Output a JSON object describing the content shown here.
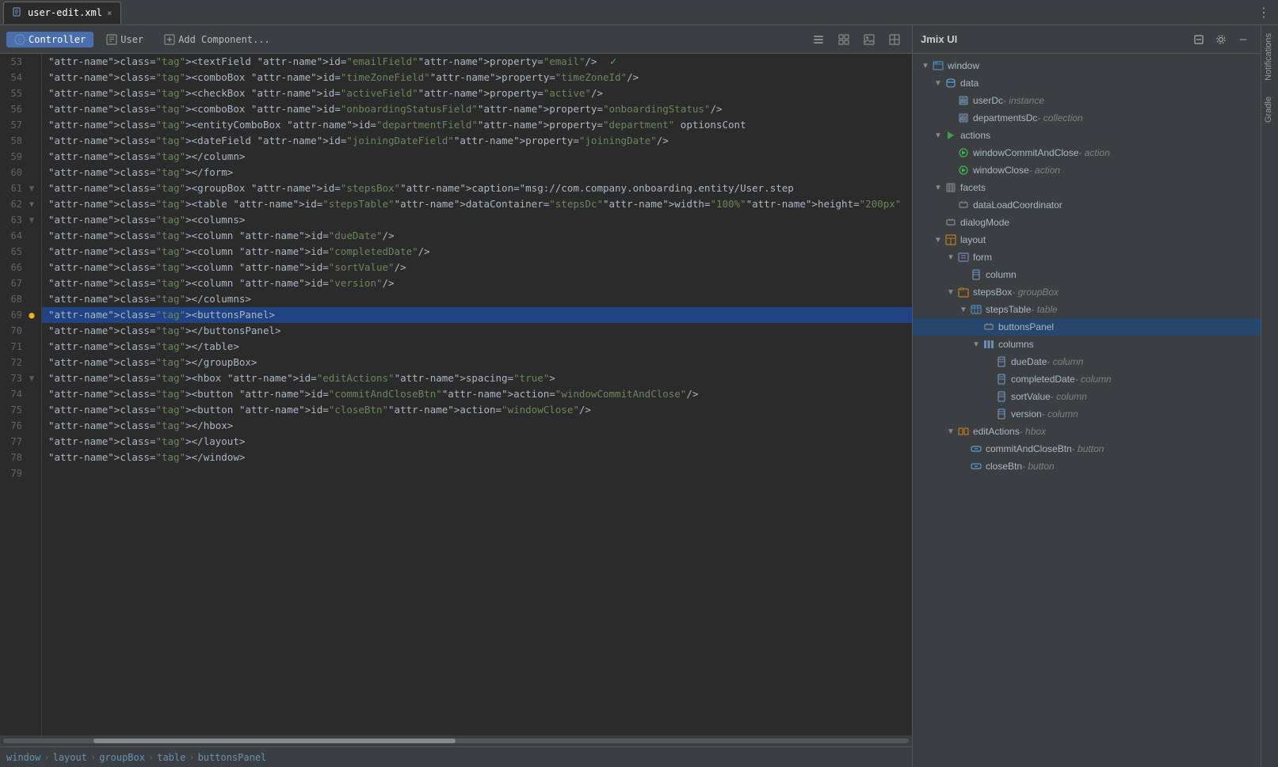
{
  "tab": {
    "filename": "user-edit.xml",
    "close_label": "×"
  },
  "editor_toolbar": {
    "tabs": [
      {
        "id": "controller",
        "label": "Controller",
        "icon": "controller-icon",
        "active": true
      },
      {
        "id": "user",
        "label": "User",
        "icon": "user-icon",
        "active": false
      },
      {
        "id": "add_component",
        "label": "Add Component...",
        "icon": "add-icon",
        "active": false
      }
    ],
    "buttons": [
      "list-view-icon",
      "grid-view-icon",
      "image-icon",
      "image2-icon"
    ]
  },
  "code": {
    "lines": [
      {
        "num": 53,
        "indent": 3,
        "content": "<textField id=\"emailField\" property=\"email\"/>",
        "has_fold": false,
        "has_warning": false,
        "checkmark": true
      },
      {
        "num": 54,
        "indent": 3,
        "content": "<comboBox id=\"timeZoneField\" property=\"timeZoneId\"/>",
        "has_fold": false,
        "has_warning": false
      },
      {
        "num": 55,
        "indent": 3,
        "content": "<checkBox id=\"activeField\" property=\"active\"/>",
        "has_fold": false,
        "has_warning": false
      },
      {
        "num": 56,
        "indent": 3,
        "content": "<comboBox id=\"onboardingStatusField\" property=\"onboardingStatus\"/>",
        "has_fold": false,
        "has_warning": false
      },
      {
        "num": 57,
        "indent": 3,
        "content": "<entityComboBox id=\"departmentField\" property=\"department\" optionsCont",
        "has_fold": false,
        "has_warning": false
      },
      {
        "num": 58,
        "indent": 3,
        "content": "<dateField id=\"joiningDateField\" property=\"joiningDate\"/>",
        "has_fold": false,
        "has_warning": false
      },
      {
        "num": 59,
        "indent": 2,
        "content": "</column>",
        "has_fold": false,
        "has_warning": false
      },
      {
        "num": 60,
        "indent": 2,
        "content": "</form>",
        "has_fold": false,
        "has_warning": false
      },
      {
        "num": 61,
        "indent": 2,
        "content": "<groupBox id=\"stepsBox\" caption=\"msg://com.company.onboarding.entity/User.step",
        "has_fold": true,
        "has_warning": false
      },
      {
        "num": 62,
        "indent": 3,
        "content": "<table id=\"stepsTable\" dataContainer=\"stepsDc\" width=\"100%\" height=\"200px\"",
        "has_fold": true,
        "has_warning": false
      },
      {
        "num": 63,
        "indent": 4,
        "content": "<columns>",
        "has_fold": true,
        "has_warning": false
      },
      {
        "num": 64,
        "indent": 5,
        "content": "<column id=\"dueDate\"/>",
        "has_fold": false,
        "has_warning": false
      },
      {
        "num": 65,
        "indent": 5,
        "content": "<column id=\"completedDate\"/>",
        "has_fold": false,
        "has_warning": false
      },
      {
        "num": 66,
        "indent": 5,
        "content": "<column id=\"sortValue\"/>",
        "has_fold": false,
        "has_warning": false
      },
      {
        "num": 67,
        "indent": 5,
        "content": "<column id=\"version\"/>",
        "has_fold": false,
        "has_warning": false
      },
      {
        "num": 68,
        "indent": 4,
        "content": "</columns>",
        "has_fold": false,
        "has_warning": false
      },
      {
        "num": 69,
        "indent": 4,
        "content": "<buttonsPanel>",
        "has_fold": false,
        "has_warning": true,
        "selected": true
      },
      {
        "num": 70,
        "indent": 4,
        "content": "</buttonsPanel>",
        "has_fold": false,
        "has_warning": false
      },
      {
        "num": 71,
        "indent": 3,
        "content": "</table>",
        "has_fold": false,
        "has_warning": false
      },
      {
        "num": 72,
        "indent": 2,
        "content": "</groupBox>",
        "has_fold": false,
        "has_warning": false
      },
      {
        "num": 73,
        "indent": 2,
        "content": "<hbox id=\"editActions\" spacing=\"true\">",
        "has_fold": true,
        "has_warning": false
      },
      {
        "num": 74,
        "indent": 3,
        "content": "<button id=\"commitAndCloseBtn\" action=\"windowCommitAndClose\"/>",
        "has_fold": false,
        "has_warning": false
      },
      {
        "num": 75,
        "indent": 3,
        "content": "<button id=\"closeBtn\" action=\"windowClose\"/>",
        "has_fold": false,
        "has_warning": false
      },
      {
        "num": 76,
        "indent": 2,
        "content": "</hbox>",
        "has_fold": false,
        "has_warning": false
      },
      {
        "num": 77,
        "indent": 1,
        "content": "</layout>",
        "has_fold": false,
        "has_warning": false
      },
      {
        "num": 78,
        "indent": 0,
        "content": "</window>",
        "has_fold": false,
        "has_warning": false
      },
      {
        "num": 79,
        "indent": 0,
        "content": "",
        "has_fold": false,
        "has_warning": false
      }
    ]
  },
  "breadcrumb": {
    "items": [
      "window",
      "layout",
      "groupBox",
      "table",
      "buttonsPanel"
    ]
  },
  "right_panel": {
    "title": "Jmix UI",
    "tree": {
      "nodes": [
        {
          "id": "window",
          "label": "window",
          "type": "",
          "depth": 0,
          "expanded": true,
          "icon": "window-icon"
        },
        {
          "id": "data",
          "label": "data",
          "type": "",
          "depth": 1,
          "expanded": true,
          "icon": "data-icon"
        },
        {
          "id": "userDc",
          "label": "userDc",
          "type": "instance",
          "depth": 2,
          "expanded": false,
          "icon": "dc-icon"
        },
        {
          "id": "departmentsDc",
          "label": "departmentsDc",
          "type": "collection",
          "depth": 2,
          "expanded": false,
          "icon": "dc-icon"
        },
        {
          "id": "actions",
          "label": "actions",
          "type": "",
          "depth": 1,
          "expanded": true,
          "icon": "actions-icon"
        },
        {
          "id": "windowCommitAndClose",
          "label": "windowCommitAndClose",
          "type": "action",
          "depth": 2,
          "expanded": false,
          "icon": "action-icon"
        },
        {
          "id": "windowClose",
          "label": "windowClose",
          "type": "action",
          "depth": 2,
          "expanded": false,
          "icon": "action-icon"
        },
        {
          "id": "facets",
          "label": "facets",
          "type": "",
          "depth": 1,
          "expanded": true,
          "icon": "facets-icon"
        },
        {
          "id": "dataLoadCoordinator",
          "label": "dataLoadCoordinator",
          "type": "",
          "depth": 2,
          "expanded": false,
          "icon": "component-icon"
        },
        {
          "id": "dialogMode",
          "label": "dialogMode",
          "type": "",
          "depth": 1,
          "expanded": false,
          "icon": "component-icon"
        },
        {
          "id": "layout",
          "label": "layout",
          "type": "",
          "depth": 1,
          "expanded": true,
          "icon": "layout-icon"
        },
        {
          "id": "form",
          "label": "form",
          "type": "",
          "depth": 2,
          "expanded": true,
          "icon": "form-icon"
        },
        {
          "id": "column",
          "label": "column",
          "type": "",
          "depth": 3,
          "expanded": false,
          "icon": "column-icon"
        },
        {
          "id": "stepsBox",
          "label": "stepsBox",
          "type": "groupBox",
          "depth": 2,
          "expanded": true,
          "icon": "groupbox-icon"
        },
        {
          "id": "stepsTable",
          "label": "stepsTable",
          "type": "table",
          "depth": 3,
          "expanded": true,
          "icon": "table-icon"
        },
        {
          "id": "buttonsPanel",
          "label": "buttonsPanel",
          "type": "",
          "depth": 4,
          "expanded": false,
          "icon": "component-icon"
        },
        {
          "id": "columns",
          "label": "columns",
          "type": "",
          "depth": 4,
          "expanded": true,
          "icon": "columns-icon"
        },
        {
          "id": "dueDate",
          "label": "dueDate",
          "type": "column",
          "depth": 5,
          "expanded": false,
          "icon": "column-icon"
        },
        {
          "id": "completedDate",
          "label": "completedDate",
          "type": "column",
          "depth": 5,
          "expanded": false,
          "icon": "column-icon"
        },
        {
          "id": "sortValue",
          "label": "sortValue",
          "type": "column",
          "depth": 5,
          "expanded": false,
          "icon": "column-icon"
        },
        {
          "id": "version",
          "label": "version",
          "type": "column",
          "depth": 5,
          "expanded": false,
          "icon": "column-icon"
        },
        {
          "id": "editActions",
          "label": "editActions",
          "type": "hbox",
          "depth": 2,
          "expanded": true,
          "icon": "hbox-icon"
        },
        {
          "id": "commitAndCloseBtn",
          "label": "commitAndCloseBtn",
          "type": "button",
          "depth": 3,
          "expanded": false,
          "icon": "button-icon"
        },
        {
          "id": "closeBtn",
          "label": "closeBtn",
          "type": "button",
          "depth": 3,
          "expanded": false,
          "icon": "button-icon"
        }
      ]
    }
  },
  "side_strip": {
    "items": [
      "Notifications",
      "Gradle"
    ]
  }
}
